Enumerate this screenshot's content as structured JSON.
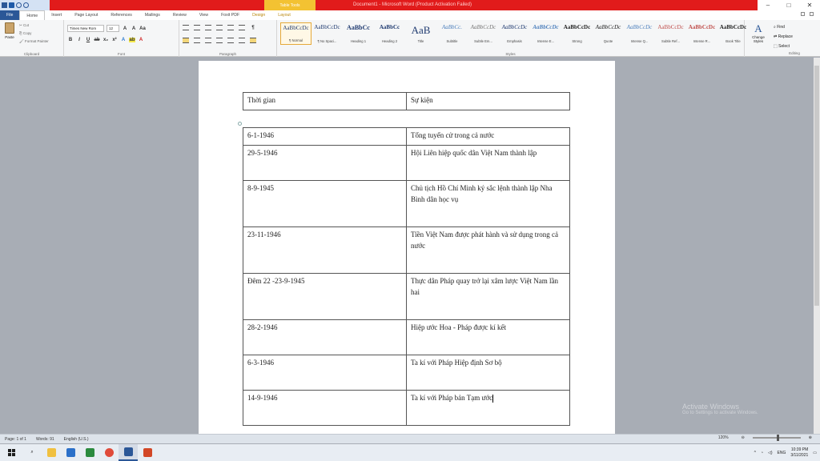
{
  "window": {
    "title": "Document1 - Microsoft Word (Product Activation Failed)",
    "context_tab": "Table Tools"
  },
  "ribbon_tabs": [
    "File",
    "Home",
    "Insert",
    "Page Layout",
    "References",
    "Mailings",
    "Review",
    "View",
    "Foxit PDF",
    "Design",
    "Layout"
  ],
  "clipboard": {
    "paste": "Paste",
    "cut": "Cut",
    "copy": "Copy",
    "format_painter": "Format Painter",
    "label": "Clipboard"
  },
  "font": {
    "name": "Times New Rom",
    "size": "12",
    "label": "Font"
  },
  "paragraph": {
    "label": "Paragraph"
  },
  "styles": {
    "label": "Styles",
    "items": [
      {
        "sample": "AaBbCcDc",
        "name": "¶ Normal"
      },
      {
        "sample": "AaBbCcDc",
        "name": "¶ No Spaci..."
      },
      {
        "sample": "AaBbCc",
        "name": "Heading 1"
      },
      {
        "sample": "AaBbCc",
        "name": "Heading 2"
      },
      {
        "sample": "AaB",
        "name": "Title"
      },
      {
        "sample": "AaBbCc.",
        "name": "Subtitle"
      },
      {
        "sample": "AaBbCcDc",
        "name": "Subtle Em..."
      },
      {
        "sample": "AaBbCcDc",
        "name": "Emphasis"
      },
      {
        "sample": "AaBbCcDc",
        "name": "Intense E..."
      },
      {
        "sample": "AaBbCcDc",
        "name": "Strong"
      },
      {
        "sample": "AaBbCcDc",
        "name": "Quote"
      },
      {
        "sample": "AaBbCcDc",
        "name": "Intense Q..."
      },
      {
        "sample": "AaBbCcDc",
        "name": "Subtle Ref..."
      },
      {
        "sample": "AaBbCcDc",
        "name": "Intense R..."
      },
      {
        "sample": "AaBbCcDc",
        "name": "Book Title"
      }
    ],
    "change_styles": "Change Styles"
  },
  "editing": {
    "find": "Find",
    "replace": "Replace",
    "select": "Select",
    "label": "Editing"
  },
  "document": {
    "header_table": {
      "col1": "Thời gian",
      "col2": "Sự kiện"
    },
    "rows": [
      {
        "date": "6-1-1946",
        "event": "Tổng tuyển cử trong cả nước"
      },
      {
        "date": "29-5-1946",
        "event": "Hội Liên hiệp quốc dân Việt Nam thành lập"
      },
      {
        "date": "8-9-1945",
        "event": "Chủ tịch Hồ Chí Minh ký sắc lệnh thành lập Nha Bình dân học vụ"
      },
      {
        "date": "23-11-1946",
        "event": "Tiền Việt Nam được phát hành và sử dụng trong cả nước"
      },
      {
        "date": "Đêm 22 -23-9-1945",
        "event": "Thực dân Pháp quay trở lại xâm lược Việt Nam lần hai"
      },
      {
        "date": "28-2-1946",
        "event": "Hiệp ước Hoa - Pháp được kí kết"
      },
      {
        "date": "6-3-1946",
        "event": "Ta kí với Pháp Hiệp định Sơ bộ"
      },
      {
        "date": "14-9-1946",
        "event": "Ta kí với Pháp bản Tạm ước"
      }
    ]
  },
  "watermark": {
    "title": "Activate Windows",
    "subtitle": "Go to Settings to activate Windows."
  },
  "status": {
    "page": "Page: 1 of 1",
    "words": "Words: 91",
    "language": "English (U.S.)",
    "zoom": "120%"
  },
  "taskbar": {
    "lang": "ENG",
    "time": "10:39 PM",
    "date": "3/11/2021"
  }
}
